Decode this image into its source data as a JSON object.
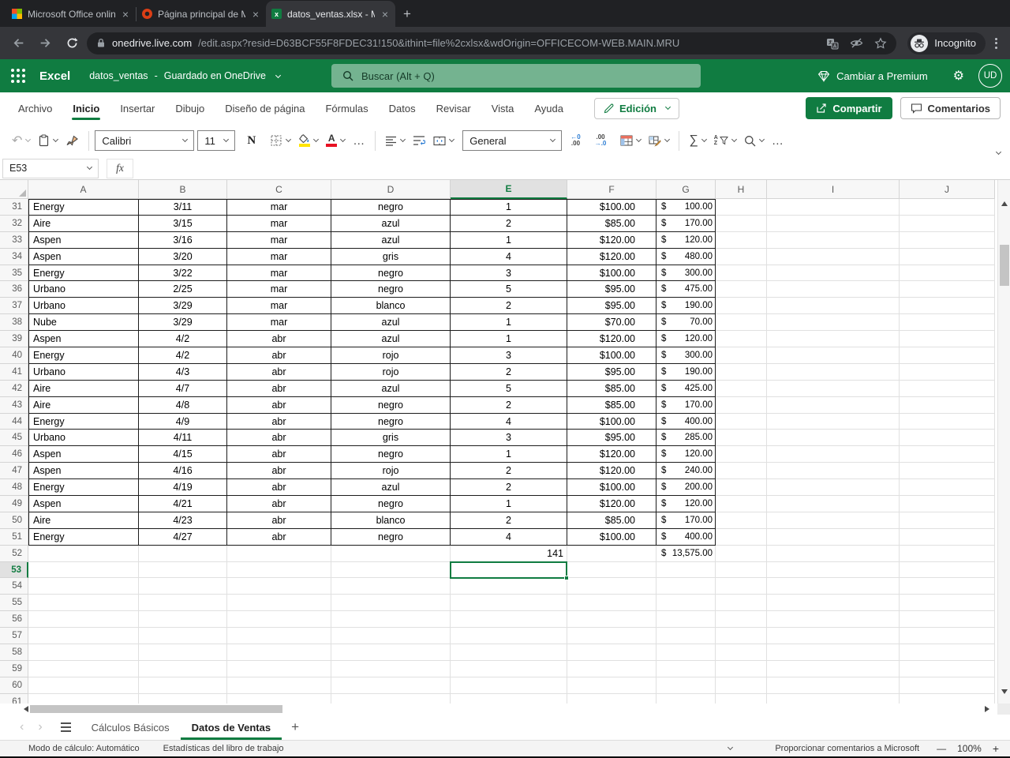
{
  "browser": {
    "tabs": [
      {
        "title": "Microsoft Office online grat",
        "icon": "microsoft",
        "active": false
      },
      {
        "title": "Página principal de Microso",
        "icon": "office",
        "active": false
      },
      {
        "title": "datos_ventas.xlsx - Micros",
        "icon": "excel",
        "active": true
      }
    ],
    "new_tab": "+",
    "url_domain": "onedrive.live.com",
    "url_path": "/edit.aspx?resid=D63BCF55F8FDEC31!150&ithint=file%2cxlsx&wdOrigin=OFFICECOM-WEB.MAIN.MRU",
    "incognito_label": "Incognito"
  },
  "header": {
    "app_name": "Excel",
    "doc_name": "datos_ventas",
    "separator": "-",
    "saved_status": "Guardado en OneDrive",
    "search_placeholder": "Buscar (Alt + Q)",
    "premium_label": "Cambiar a Premium",
    "avatar_initials": "UD"
  },
  "ribbon": {
    "tabs": [
      "Archivo",
      "Inicio",
      "Insertar",
      "Dibujo",
      "Diseño de página",
      "Fórmulas",
      "Datos",
      "Revisar",
      "Vista",
      "Ayuda"
    ],
    "active_tab": "Inicio",
    "edit_mode_label": "Edición",
    "share_label": "Compartir",
    "comments_label": "Comentarios"
  },
  "toolbar": {
    "font_name": "Calibri",
    "font_size": "11",
    "bold_label": "N",
    "number_format": "General"
  },
  "formula_bar": {
    "cell_reference": "E53",
    "fx_label": "fx",
    "formula_value": ""
  },
  "icons": {
    "close_tab": "×",
    "undo": "↶",
    "more": "…",
    "sum": "∑",
    "gear": "⚙",
    "dec1_top": "←0",
    "dec1_bot": ".00",
    "dec2_top": ".00",
    "dec2_bot": "→.0",
    "sort_a": "A",
    "sort_z": "Z",
    "sheet_prev": "‹",
    "sheet_next": "›",
    "add_sheet": "+"
  },
  "sheet": {
    "columns": [
      "A",
      "B",
      "C",
      "D",
      "E",
      "F",
      "G",
      "H",
      "I",
      "J"
    ],
    "selected_column": "E",
    "selected_row": 53,
    "selected_cell": "E53",
    "first_row": 31,
    "last_row": 61,
    "data_first_row": 31,
    "rows": [
      [
        "Energy",
        "3/11",
        "mar",
        "negro",
        "1",
        "$100.00",
        "$ 100.00"
      ],
      [
        "Aire",
        "3/15",
        "mar",
        "azul",
        "2",
        "$85.00",
        "$ 170.00"
      ],
      [
        "Aspen",
        "3/16",
        "mar",
        "azul",
        "1",
        "$120.00",
        "$ 120.00"
      ],
      [
        "Aspen",
        "3/20",
        "mar",
        "gris",
        "4",
        "$120.00",
        "$ 480.00"
      ],
      [
        "Energy",
        "3/22",
        "mar",
        "negro",
        "3",
        "$100.00",
        "$ 300.00"
      ],
      [
        "Urbano",
        "2/25",
        "mar",
        "negro",
        "5",
        "$95.00",
        "$ 475.00"
      ],
      [
        "Urbano",
        "3/29",
        "mar",
        "blanco",
        "2",
        "$95.00",
        "$ 190.00"
      ],
      [
        "Nube",
        "3/29",
        "mar",
        "azul",
        "1",
        "$70.00",
        "$ 70.00"
      ],
      [
        "Aspen",
        "4/2",
        "abr",
        "azul",
        "1",
        "$120.00",
        "$ 120.00"
      ],
      [
        "Energy",
        "4/2",
        "abr",
        "rojo",
        "3",
        "$100.00",
        "$ 300.00"
      ],
      [
        "Urbano",
        "4/3",
        "abr",
        "rojo",
        "2",
        "$95.00",
        "$ 190.00"
      ],
      [
        "Aire",
        "4/7",
        "abr",
        "azul",
        "5",
        "$85.00",
        "$ 425.00"
      ],
      [
        "Aire",
        "4/8",
        "abr",
        "negro",
        "2",
        "$85.00",
        "$ 170.00"
      ],
      [
        "Energy",
        "4/9",
        "abr",
        "negro",
        "4",
        "$100.00",
        "$ 400.00"
      ],
      [
        "Urbano",
        "4/11",
        "abr",
        "gris",
        "3",
        "$95.00",
        "$ 285.00"
      ],
      [
        "Aspen",
        "4/15",
        "abr",
        "negro",
        "1",
        "$120.00",
        "$ 120.00"
      ],
      [
        "Aspen",
        "4/16",
        "abr",
        "rojo",
        "2",
        "$120.00",
        "$ 240.00"
      ],
      [
        "Energy",
        "4/19",
        "abr",
        "azul",
        "2",
        "$100.00",
        "$ 200.00"
      ],
      [
        "Aspen",
        "4/21",
        "abr",
        "negro",
        "1",
        "$120.00",
        "$ 120.00"
      ],
      [
        "Aire",
        "4/23",
        "abr",
        "blanco",
        "2",
        "$85.00",
        "$ 170.00"
      ],
      [
        "Energy",
        "4/27",
        "abr",
        "negro",
        "4",
        "$100.00",
        "$ 400.00"
      ]
    ],
    "totals_row": {
      "row": 52,
      "quantity_total": "141",
      "amount_total": "$ 13,575.00"
    }
  },
  "sheet_tabs": {
    "tabs": [
      "Cálculos Básicos",
      "Datos de Ventas"
    ],
    "active": "Datos de Ventas"
  },
  "status_bar": {
    "calc_mode": "Modo de cálculo: Automático",
    "workbook_stats": "Estadísticas del libro de trabajo",
    "feedback": "Proporcionar comentarios a Microsoft",
    "zoom_out": "—",
    "zoom_level": "100%",
    "zoom_in": "+"
  }
}
